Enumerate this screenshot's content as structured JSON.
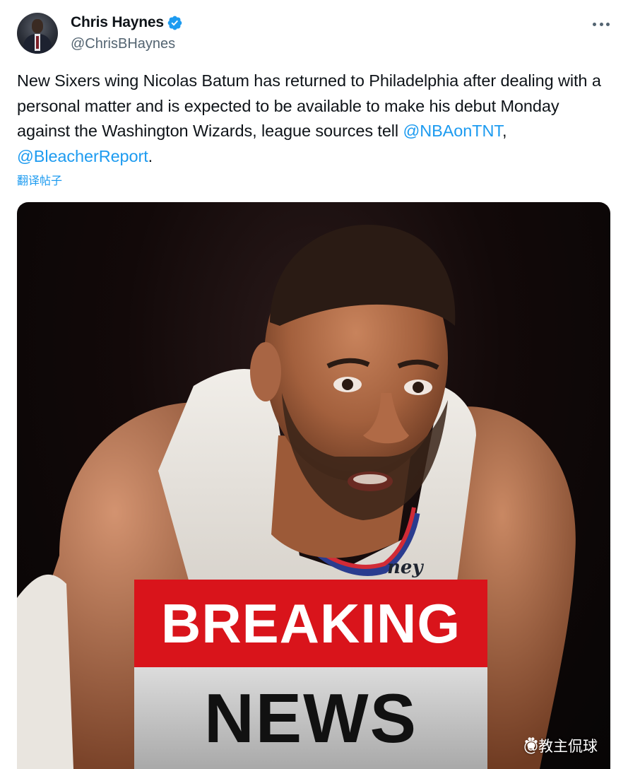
{
  "tweet": {
    "display_name": "Chris Haynes",
    "handle": "@ChrisBHaynes",
    "text_main": "New Sixers wing Nicolas Batum has returned to Philadelphia after dealing with a personal matter and is expected to be available to make his debut Monday against the Washington Wizards, league sources tell ",
    "mention_1": "@NBAonTNT",
    "separator": ", ",
    "mention_2": "@BleacherReport",
    "text_end": ".",
    "translate_label": "翻译帖子"
  },
  "media": {
    "banner_top": "BREAKING",
    "banner_bottom": "NEWS",
    "jersey_text": "ney",
    "watermark": "@教主侃球"
  },
  "colors": {
    "link": "#1d9bf0",
    "verified": "#1d9bf0",
    "breaking_red": "#d9141b",
    "secondary_text": "#536471"
  },
  "icons": {
    "verified": "verified-badge-icon",
    "more": "more-options-icon",
    "watermark": "paw-icon"
  }
}
